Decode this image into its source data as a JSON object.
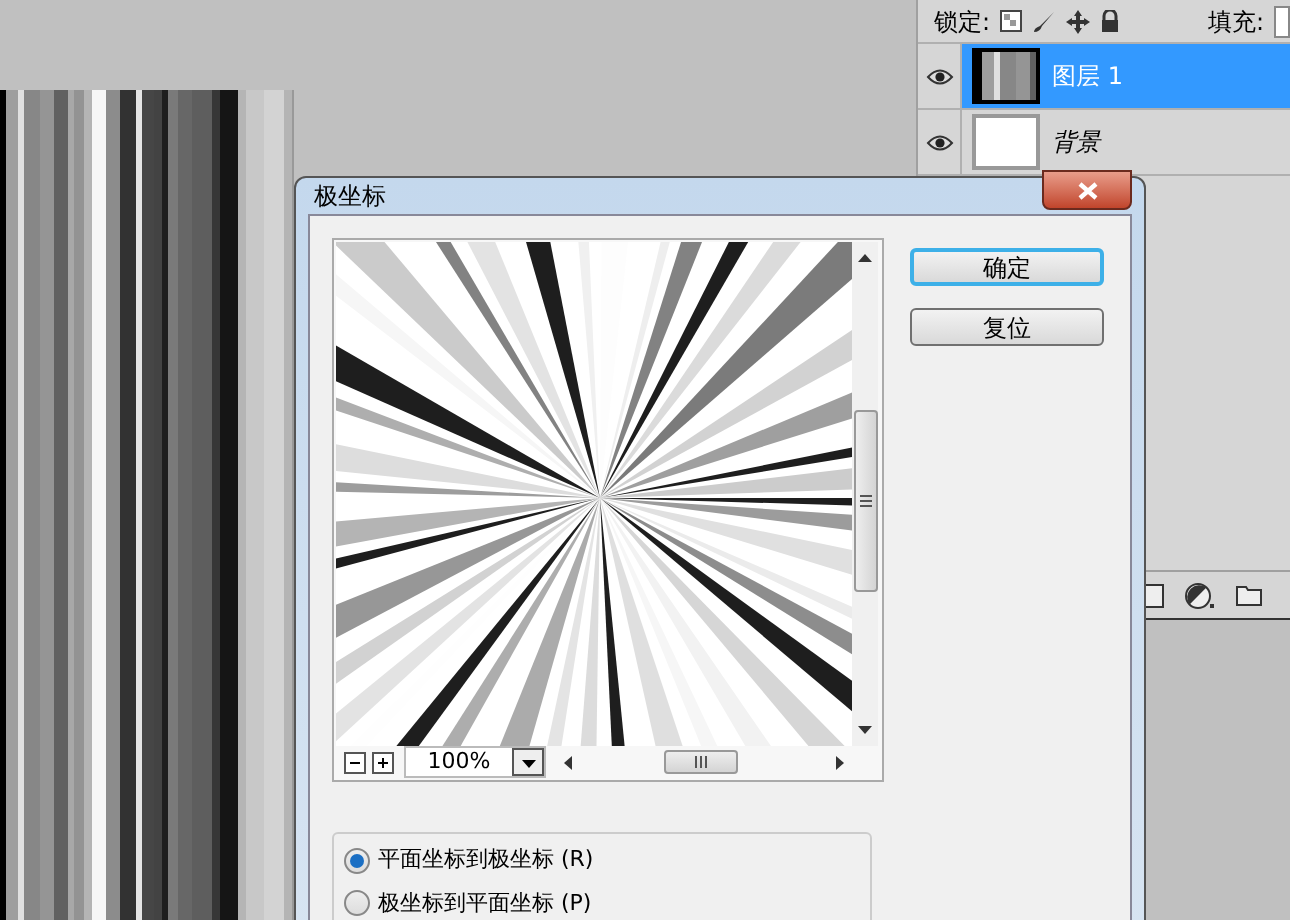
{
  "layers_panel": {
    "lock_label": "锁定:",
    "fill_label": "填充:",
    "layers": [
      {
        "name": "图层 1",
        "selected": true,
        "italic": false
      },
      {
        "name": "背景",
        "selected": false,
        "italic": true
      }
    ]
  },
  "dialog": {
    "title": "极坐标",
    "zoom": "100%",
    "buttons": [
      {
        "label": "确定",
        "default": true
      },
      {
        "label": "复位",
        "default": false
      }
    ],
    "options": [
      {
        "label": "平面坐标到极坐标 (R)",
        "selected": true
      },
      {
        "label": "极坐标到平面坐标 (P)",
        "selected": false
      }
    ]
  }
}
